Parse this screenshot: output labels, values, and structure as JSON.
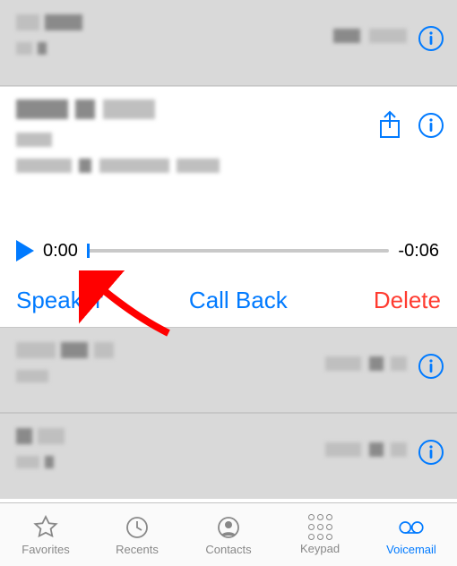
{
  "voicemails": [
    {
      "caller": "████",
      "date": "███",
      "detail": "████"
    },
    {
      "caller": "████ ████",
      "phone": "██",
      "transcript": "████ █ █████ ████"
    },
    {
      "caller": "████ ██",
      "date": "██",
      "detail": "████ ██ ██"
    },
    {
      "caller": "█ ██",
      "date": "██",
      "detail": "███"
    }
  ],
  "player": {
    "elapsed": "0:00",
    "remaining": "-0:06"
  },
  "actions": {
    "speaker": "Speaker",
    "callback": "Call Back",
    "delete": "Delete"
  },
  "tabs": {
    "favorites": "Favorites",
    "recents": "Recents",
    "contacts": "Contacts",
    "keypad": "Keypad",
    "voicemail": "Voicemail"
  },
  "colors": {
    "tint": "#007aff",
    "danger": "#ff3b30"
  }
}
